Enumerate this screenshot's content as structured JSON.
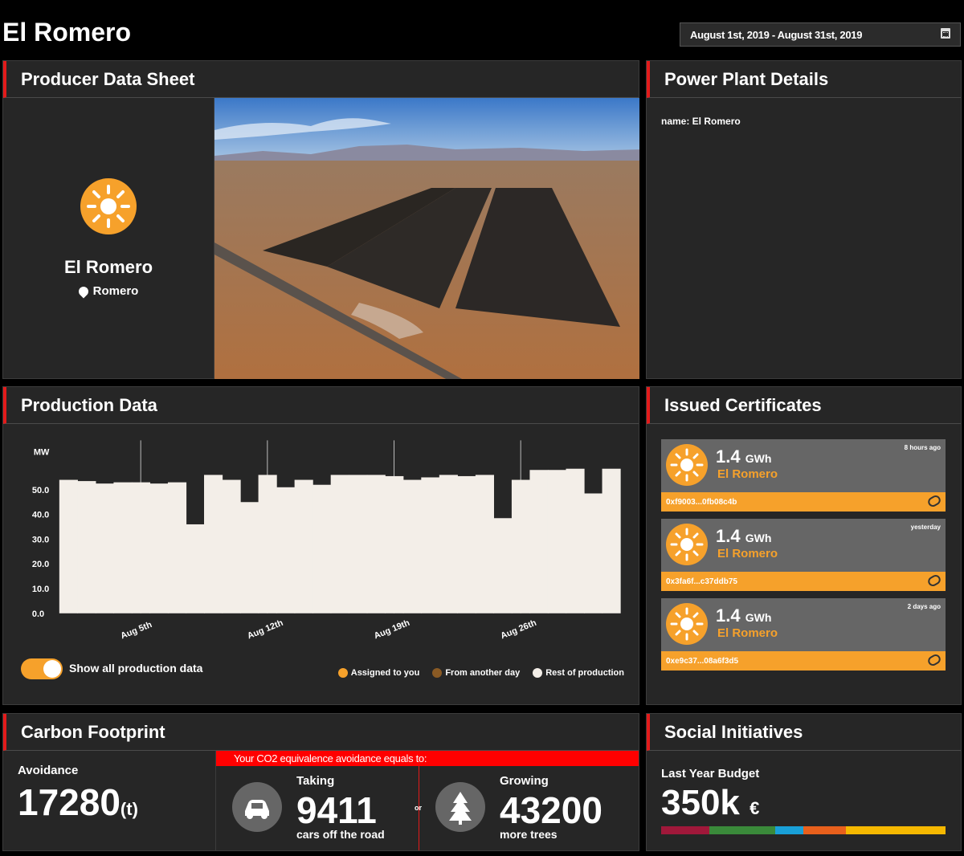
{
  "header": {
    "title": "El Romero",
    "date_range": "August 1st, 2019 - August 31st, 2019"
  },
  "producer": {
    "panel_title": "Producer Data Sheet",
    "name": "El Romero",
    "location": "Romero"
  },
  "details": {
    "panel_title": "Power Plant Details",
    "name_line": "name: El Romero"
  },
  "production": {
    "panel_title": "Production Data",
    "toggle_label": "Show all production data",
    "legend": [
      {
        "label": "Assigned to you",
        "color": "#f6a12b"
      },
      {
        "label": "From another day",
        "color": "#8a5a24"
      },
      {
        "label": "Rest of production",
        "color": "#f3eee8"
      }
    ]
  },
  "chart_data": {
    "type": "bar",
    "ylabel": "MW",
    "ylim": [
      0,
      70
    ],
    "yticks": [
      "0.0",
      "10.0",
      "20.0",
      "30.0",
      "40.0",
      "50.0"
    ],
    "xtick_labels": [
      "Aug 5th",
      "Aug 12th",
      "Aug 19th",
      "Aug 26th"
    ],
    "xtick_days": [
      5,
      12,
      19,
      26
    ],
    "days": [
      1,
      2,
      3,
      4,
      5,
      6,
      7,
      8,
      9,
      10,
      11,
      12,
      13,
      14,
      15,
      16,
      17,
      18,
      19,
      20,
      21,
      22,
      23,
      24,
      25,
      26,
      27,
      28,
      29,
      30,
      31
    ],
    "values": [
      54,
      53.5,
      52.5,
      53,
      53,
      52.5,
      53,
      36,
      56,
      54,
      45,
      56,
      51,
      54,
      52,
      56,
      56,
      56,
      55.5,
      54,
      55,
      56,
      55.5,
      56,
      38.5,
      54,
      58,
      58,
      58.5,
      48.5,
      58.5
    ],
    "series_color": "#f3eee8",
    "grid": false
  },
  "certificates": {
    "panel_title": "Issued Certificates",
    "items": [
      {
        "amount": "1.4",
        "unit": "GWh",
        "plant": "El Romero",
        "when": "8 hours ago",
        "hash": "0xf9003...0fb08c4b"
      },
      {
        "amount": "1.4",
        "unit": "GWh",
        "plant": "El Romero",
        "when": "yesterday",
        "hash": "0x3fa6f...c37ddb75"
      },
      {
        "amount": "1.4",
        "unit": "GWh",
        "plant": "El Romero",
        "when": "2 days ago",
        "hash": "0xe9c37...08a6f3d5"
      }
    ]
  },
  "carbon": {
    "panel_title": "Carbon Footprint",
    "avoidance_label": "Avoidance",
    "avoidance_value": "17280",
    "avoidance_unit": "(t)",
    "banner": "Your CO2 equivalence avoidance equals to:",
    "cars_top": "Taking",
    "cars_value": "9411",
    "cars_bottom": "cars off the road",
    "or_text": "or",
    "trees_top": "Growing",
    "trees_value": "43200",
    "trees_bottom": "more trees"
  },
  "social": {
    "panel_title": "Social Initiatives",
    "budget_label": "Last Year Budget",
    "budget_value": "350k",
    "budget_currency": "€",
    "budget_colors": [
      "#a0183a",
      "#3a8a3a",
      "#19a0d8",
      "#e8601c",
      "#f5b800"
    ],
    "budget_shares": [
      0.17,
      0.23,
      0.1,
      0.15,
      0.35
    ]
  }
}
